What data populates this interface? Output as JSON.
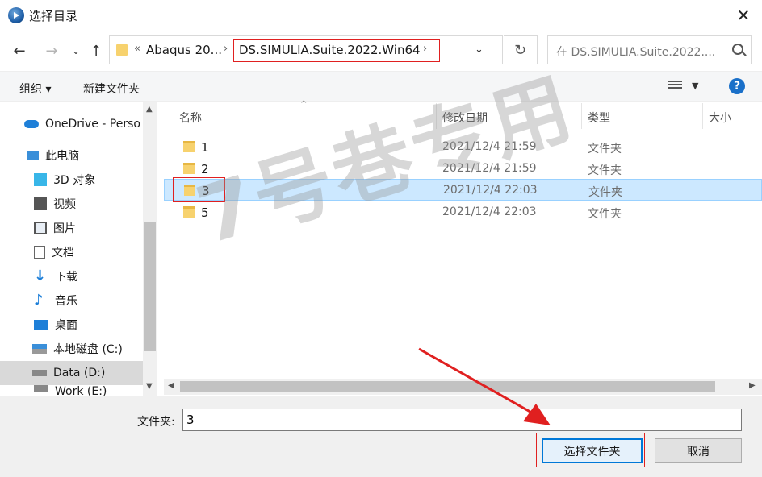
{
  "window": {
    "title": "选择目录"
  },
  "address": {
    "crumbs": [
      "Abaqus 20...",
      "DS.SIMULIA.Suite.2022.Win64"
    ],
    "overflow": "«",
    "search_placeholder": "在 DS.SIMULIA.Suite.2022...."
  },
  "toolbar": {
    "organize": "组织 ▾",
    "new_folder": "新建文件夹"
  },
  "sidebar": {
    "items": [
      {
        "label": "OneDrive - Perso",
        "icon": "cloud-icon"
      },
      {
        "label": "此电脑",
        "icon": "computer-icon"
      },
      {
        "label": "3D 对象",
        "icon": "cube-icon"
      },
      {
        "label": "视频",
        "icon": "video-icon"
      },
      {
        "label": "图片",
        "icon": "picture-icon"
      },
      {
        "label": "文档",
        "icon": "document-icon"
      },
      {
        "label": "下载",
        "icon": "download-icon"
      },
      {
        "label": "音乐",
        "icon": "music-icon"
      },
      {
        "label": "桌面",
        "icon": "desktop-icon"
      },
      {
        "label": "本地磁盘 (C:)",
        "icon": "drive-icon"
      },
      {
        "label": "Data (D:)",
        "icon": "drive-icon"
      },
      {
        "label": "Work (E:)",
        "icon": "drive-icon"
      }
    ]
  },
  "list": {
    "columns": {
      "name": "名称",
      "modified": "修改日期",
      "type": "类型",
      "size": "大小"
    },
    "rows": [
      {
        "name": "1",
        "modified": "2021/12/4 21:59",
        "type": "文件夹"
      },
      {
        "name": "2",
        "modified": "2021/12/4 21:59",
        "type": "文件夹"
      },
      {
        "name": "3",
        "modified": "2021/12/4 22:03",
        "type": "文件夹"
      },
      {
        "name": "5",
        "modified": "2021/12/4 22:03",
        "type": "文件夹"
      }
    ]
  },
  "watermark": "7号巷专用",
  "bottom": {
    "folder_label": "文件夹:",
    "folder_value": "3",
    "select_button": "选择文件夹",
    "cancel_button": "取消"
  },
  "colors": {
    "accent": "#0078d7",
    "annotation": "#e02020",
    "selection": "#cce8ff"
  }
}
